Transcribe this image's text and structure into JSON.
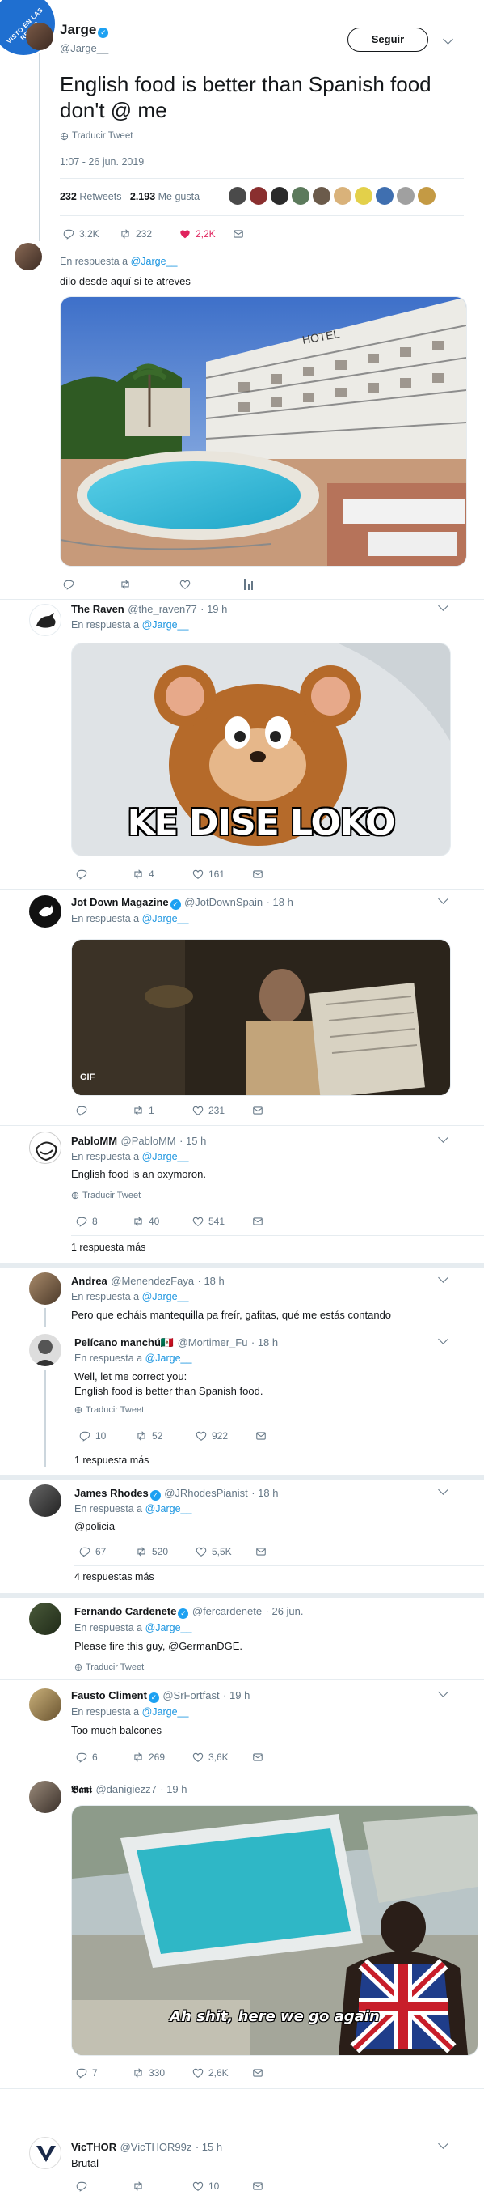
{
  "watermark": "VISTO EN LAS REDES",
  "main": {
    "name": "Jarge",
    "handle": "@Jarge__",
    "follow": "Seguir",
    "text": "English food is better than Spanish food don't @ me",
    "translate": "Traducir Tweet",
    "timestamp": "1:07 - 26 jun. 2019",
    "retweets_count": "232",
    "retweets_label": "Retweets",
    "likes_count": "2.193",
    "likes_label": "Me gusta",
    "reply_count": "3,2K",
    "rt_count": "232",
    "like_count": "2,2K"
  },
  "r1": {
    "reply_to": "En respuesta a",
    "to_handle": "@Jarge__",
    "text": "dilo desde aquí si te atreves",
    "hotel_sign": "HOTEL"
  },
  "r2": {
    "name": "The Raven",
    "handle": "@the_raven77",
    "time": "· 19 h",
    "reply_to": "En respuesta a",
    "to_handle": "@Jarge__",
    "caption": "KE DISE LOKO",
    "rt": "4",
    "like": "161"
  },
  "r3": {
    "name": "Jot Down Magazine",
    "handle": "@JotDownSpain",
    "time": "· 18 h",
    "reply_to": "En respuesta a",
    "to_handle": "@Jarge__",
    "gif": "GIF",
    "rt": "1",
    "like": "231"
  },
  "r4": {
    "name": "PabloMM",
    "handle": "@PabloMM",
    "time": "· 15 h",
    "reply_to": "En respuesta a",
    "to_handle": "@Jarge__",
    "text": "English food is an oxymoron.",
    "translate": "Traducir Tweet",
    "reply": "8",
    "rt": "40",
    "like": "541",
    "more": "1 respuesta más"
  },
  "r5": {
    "name": "Andrea",
    "handle": "@MenendezFaya",
    "time": "· 18 h",
    "reply_to": "En respuesta a",
    "to_handle": "@Jarge__",
    "text": "Pero que echáis mantequilla pa freír, gafitas, qué me estás contando"
  },
  "r6": {
    "name": "Pelícano manchú🇲🇽",
    "handle": "@Mortimer_Fu",
    "time": "· 18 h",
    "reply_to": "En respuesta a",
    "to_handle": "@Jarge__",
    "text1": "Well, let me correct you:",
    "text2": "English food is better than Spanish food.",
    "translate": "Traducir Tweet",
    "reply": "10",
    "rt": "52",
    "like": "922",
    "more": "1 respuesta más"
  },
  "r7": {
    "name": "James Rhodes",
    "handle": "@JRhodesPianist",
    "time": "· 18 h",
    "reply_to": "En respuesta a",
    "to_handle": "@Jarge__",
    "text": "@policia",
    "reply": "67",
    "rt": "520",
    "like": "5,5K",
    "more": "4 respuestas más"
  },
  "r8": {
    "name": "Fernando Cardenete",
    "handle": "@fercardenete",
    "time": "· 26 jun.",
    "reply_to": "En respuesta a",
    "to_handle": "@Jarge__",
    "text": "Please fire this guy, @GermanDGE.",
    "translate": "Traducir Tweet"
  },
  "r9": {
    "name": "Fausto Climent",
    "handle": "@SrFortfast",
    "time": "· 19 h",
    "reply_to": "En respuesta a",
    "to_handle": "@Jarge__",
    "text": "Too much balcones",
    "reply": "6",
    "rt": "269",
    "like": "3,6K"
  },
  "r10": {
    "name": "𝕭𝖆𝖓𝖎",
    "handle": "@danigiezz7",
    "time": "· 19 h",
    "caption": "Ah shit, here we go again",
    "reply": "7",
    "rt": "330",
    "like": "2,6K"
  },
  "r11": {
    "name": "VicTHOR",
    "handle": "@VicTHOR99z",
    "time": "· 15 h",
    "text": "Brutal",
    "like": "10"
  },
  "colors": {
    "accent": "#1da1f2",
    "like": "#e0245e",
    "border": "#e6ecf0",
    "muted": "#657786"
  }
}
